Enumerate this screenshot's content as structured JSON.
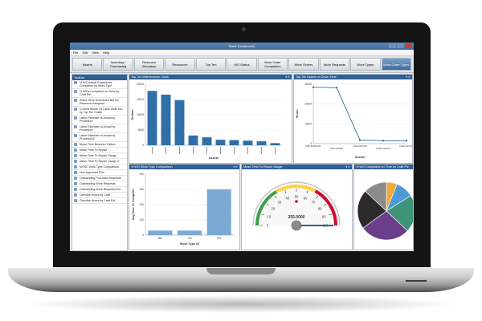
{
  "window": {
    "title": "Maint Dashboards"
  },
  "menu": [
    "File",
    "Edit",
    "View",
    "Help"
  ],
  "ribbon_tabs": [
    {
      "label": "Assets",
      "active": false
    },
    {
      "label": "Inventory / Purchasing",
      "active": false
    },
    {
      "label": "Resource Allocation",
      "active": false
    },
    {
      "label": "Resources",
      "active": false
    },
    {
      "label": "Top Ten",
      "active": false
    },
    {
      "label": "WO Status",
      "active": false
    },
    {
      "label": "Work Order Completion",
      "active": false
    },
    {
      "label": "Work Orders",
      "active": false
    },
    {
      "label": "Work Requests",
      "active": false
    },
    {
      "label": "Work Types",
      "active": false
    },
    {
      "label": "Work Order Types",
      "active": true
    }
  ],
  "sidebar": {
    "title": "Toolbar",
    "items": [
      "% WO Actual Procedures Completed by Work Type",
      "% WOs Completed on Time by Craft Pie",
      "Active WOs Scheduled But No Resource Assigned",
      "Current Month Vs Labor Avail Hrs by Top Ten Crafts",
      "Labor Estimate vs Actual by Procedure",
      "Labor Estimate vs Actual by Procedure",
      "Labor Estimate vs Actual by Procedure2",
      "Mean Time Between Failure",
      "Mean Time To Repair",
      "Mean Time To Repair Gauge",
      "Mean Time To Repair Gauge 2",
      "MOSE Work Type Comparison",
      "Non Approved POs",
      "Outstanding Purchase Requests",
      "Outstanding Work Requests",
      "Outstanding Work Requests Ext",
      "Overdue Hours by Craft",
      "Overdue Hours by Craft Ext"
    ]
  },
  "panels": {
    "top_maint_cost": {
      "title": "Top Ten Maintenance Costs",
      "xlabel": "Assets",
      "ylabel": "Dollars"
    },
    "top_downtime": {
      "title": "Top Ten Assets on Down Time",
      "xlabel": "Assets",
      "ylabel": "Hours"
    },
    "work_type_compare": {
      "title": "% WO Work Type Comparison",
      "xlabel": "Work Type ID",
      "ylabel": "Avg Hour To Complete"
    },
    "mttr_gauge": {
      "title": "Mean Time To Repair Gauge",
      "value_label": "255.0000"
    },
    "completion_pie": {
      "title": "% WO Completed on Time by Craft Pie"
    }
  },
  "chart_data": [
    {
      "type": "bar",
      "title": "Top Ten Maintenance Costs",
      "xlabel": "Assets",
      "ylabel": "Dollars",
      "ylim": [
        0,
        20000
      ],
      "yticks": [
        0,
        5000,
        10000,
        15000,
        20000
      ],
      "categories": [
        "",
        "",
        "",
        "",
        "",
        "",
        "",
        "",
        "",
        ""
      ],
      "values": [
        17800,
        16600,
        14800,
        3200,
        2600,
        1800,
        1700,
        1500,
        1300,
        700
      ],
      "color": "#2f6fa8"
    },
    {
      "type": "line",
      "title": "Top Ten Assets on Down Time",
      "xlabel": "Assets",
      "ylabel": "Hours",
      "ylim": [
        0,
        30000
      ],
      "yticks": [
        0,
        10000,
        20000,
        30000
      ],
      "x": [
        "PRD-PUMP-001",
        "PRD-CRANE",
        "CHSO-007-025",
        "CHSO-006-015",
        "CHSO-007-019"
      ],
      "values": [
        28500,
        28300,
        1800,
        1500,
        1400
      ],
      "color": "#2f6fa8"
    },
    {
      "type": "bar",
      "title": "% WO Work Type Comparison",
      "xlabel": "Work Type ID",
      "ylabel": "Avg Hour To Complete",
      "ylim": [
        0,
        400
      ],
      "yticks": [
        0,
        100,
        200,
        300,
        400
      ],
      "categories": [
        "Bat",
        "Cal",
        "PM"
      ],
      "values": [
        30,
        30,
        300
      ],
      "color": "#7aa9d4"
    },
    {
      "type": "gauge",
      "title": "Mean Time To Repair Gauge",
      "min": 0,
      "max": 100,
      "ticks": [
        0,
        10,
        20,
        30,
        40,
        50,
        60,
        70,
        80,
        90,
        100
      ],
      "pointer": 100,
      "value_label": "255.0000"
    },
    {
      "type": "pie",
      "title": "% WO Completed on Time by Craft Pie",
      "slices": [
        {
          "value": 6,
          "color": "#f2a93b"
        },
        {
          "value": 10,
          "color": "#4e9ad6"
        },
        {
          "value": 21,
          "color": "#3d9478"
        },
        {
          "value": 28,
          "color": "#6a3e8a"
        },
        {
          "value": 22,
          "color": "#2a2a2a"
        },
        {
          "value": 13,
          "color": "#8a8a8a"
        }
      ]
    }
  ]
}
